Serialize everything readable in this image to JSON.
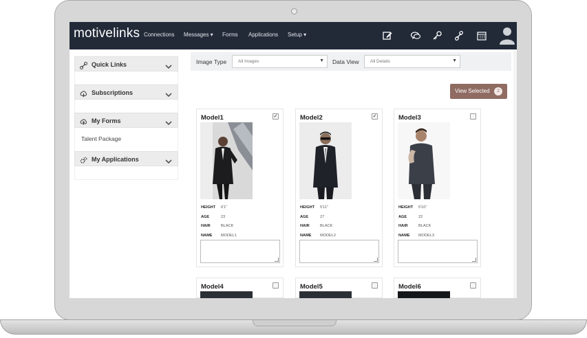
{
  "brand": {
    "logo": "motivelinks"
  },
  "nav": {
    "links": [
      "Connections",
      "Messages ▾",
      "Forms",
      "Applications",
      "Setup ▾"
    ],
    "icons": [
      "edit-icon",
      "chat-icon",
      "key-icon",
      "link-icon",
      "calendar-icon",
      "user-avatar-icon"
    ]
  },
  "sidebar": {
    "sections": [
      {
        "label": "Quick Links",
        "icon": "link-icon",
        "items": []
      },
      {
        "label": "Subscriptions",
        "icon": "cloud-icon",
        "items": []
      },
      {
        "label": "My Forms",
        "icon": "cloud-icon",
        "items": [
          "Talent Package"
        ]
      },
      {
        "label": "My Applications",
        "icon": "gears-icon",
        "items": []
      }
    ]
  },
  "filters": {
    "image_type_label": "Image Type",
    "image_type_value": "All Images",
    "data_view_label": "Data View",
    "data_view_value": "All Details"
  },
  "view_selected": {
    "label": "View Selected",
    "count": "2"
  },
  "attribute_labels": {
    "height": "HEIGHT",
    "age": "AGE",
    "hair": "HAIR",
    "name": "NAME"
  },
  "models": [
    {
      "title": "Model1",
      "checked": true,
      "height": "6'1''",
      "age": "23",
      "hair": "BLACK",
      "name": "MODEL1"
    },
    {
      "title": "Model2",
      "checked": true,
      "height": "5'11''",
      "age": "27",
      "hair": "BLACK",
      "name": "MODEL2"
    },
    {
      "title": "Model3",
      "checked": false,
      "height": "5'10''",
      "age": "22",
      "hair": "BLACK",
      "name": "MODEL3"
    },
    {
      "title": "Model4",
      "checked": false
    },
    {
      "title": "Model5",
      "checked": false
    },
    {
      "title": "Model6",
      "checked": false
    }
  ],
  "colors": {
    "navbar": "#222a38",
    "button": "#8f6b62",
    "sidebar_header": "#ececec"
  }
}
